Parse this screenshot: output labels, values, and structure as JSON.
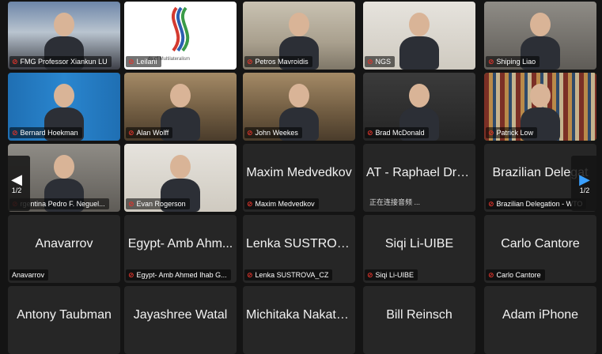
{
  "navigation": {
    "prev_page": "1/2",
    "next_page": "1/2"
  },
  "logo_text": "ds of Multilateralism",
  "tiles": [
    {
      "label": "FMG Professor Xiankun LU",
      "video": true,
      "scene": "sunset"
    },
    {
      "label": "Leilani",
      "video": true,
      "scene": "logo"
    },
    {
      "label": "Petros Mavroidis",
      "video": true,
      "scene": "room-light"
    },
    {
      "label": "NGS",
      "video": true,
      "scene": "room-white"
    },
    {
      "label": "Shiping Liao",
      "video": true,
      "scene": "room-grey"
    },
    {
      "label": "Bernard Hoekman",
      "video": true,
      "scene": "blue"
    },
    {
      "label": "Alan Wolff",
      "video": true,
      "scene": "library"
    },
    {
      "label": "John Weekes",
      "video": true,
      "scene": "library"
    },
    {
      "label": "Brad McDonald",
      "video": true,
      "scene": "dark-room"
    },
    {
      "label": "Patrick Low",
      "video": true,
      "scene": "bookshelf",
      "active": true
    },
    {
      "label": "rgentina Pedro F. Neguel...",
      "video": true,
      "scene": "room-grey"
    },
    {
      "label": "Evan Rogerson",
      "video": true,
      "scene": "room-white"
    },
    {
      "display_name": "Maxim Medvedkov",
      "label": "Maxim Medvedkov",
      "video": false
    },
    {
      "display_name": "AT - Raphael Dra...",
      "label": "正在连接音频 ...",
      "video": false,
      "status_only": true
    },
    {
      "display_name": "Brazilian Delegat",
      "label": "Brazilian Delegation - WTO",
      "video": false
    },
    {
      "display_name": "Anavarrov",
      "label": "Anavarrov",
      "video": false,
      "no_mic": true
    },
    {
      "display_name": "Egypt- Amb Ahm...",
      "label": "Egypt- Amb Ahmed Ihab G...",
      "video": false
    },
    {
      "display_name": "Lenka SUSTROV...",
      "label": "Lenka SUSTROVA_CZ",
      "video": false
    },
    {
      "display_name": "Siqi Li-UIBE",
      "label": "Siqi Li-UIBE",
      "video": false
    },
    {
      "display_name": "Carlo Cantore",
      "label": "Carlo Cantore",
      "video": false
    },
    {
      "display_name": "Antony Taubman",
      "label": "",
      "video": false
    },
    {
      "display_name": "Jayashree Watal",
      "label": "",
      "video": false
    },
    {
      "display_name": "Michitaka Nakata...",
      "label": "",
      "video": false
    },
    {
      "display_name": "Bill Reinsch",
      "label": "",
      "video": false
    },
    {
      "display_name": "Adam iPhone",
      "label": "",
      "video": false
    }
  ]
}
